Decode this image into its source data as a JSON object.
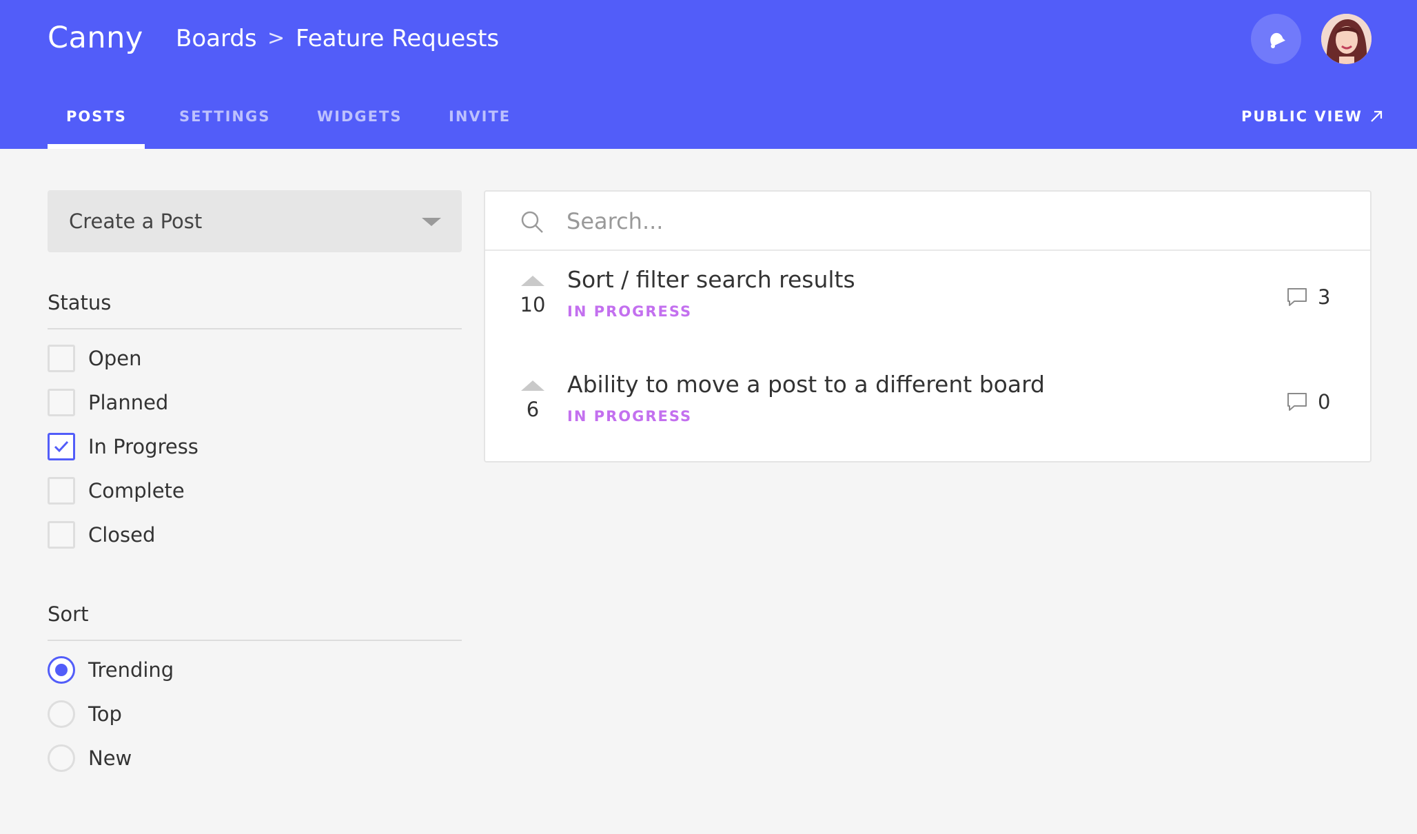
{
  "header": {
    "logo": "Canny",
    "breadcrumb": {
      "boards": "Boards",
      "separator": ">",
      "current": "Feature Requests"
    },
    "tabs": [
      {
        "label": "POSTS",
        "active": true
      },
      {
        "label": "SETTINGS",
        "active": false
      },
      {
        "label": "WIDGETS",
        "active": false
      },
      {
        "label": "INVITE",
        "active": false
      }
    ],
    "public_view": "PUBLIC VIEW",
    "icons": {
      "notifications": "bell-icon",
      "external": "arrow-up-right-icon"
    },
    "bg_color": "#525df9"
  },
  "sidebar": {
    "create_post": "Create a Post",
    "status": {
      "title": "Status",
      "options": [
        {
          "label": "Open",
          "checked": false
        },
        {
          "label": "Planned",
          "checked": false
        },
        {
          "label": "In Progress",
          "checked": true
        },
        {
          "label": "Complete",
          "checked": false
        },
        {
          "label": "Closed",
          "checked": false
        }
      ]
    },
    "sort": {
      "title": "Sort",
      "options": [
        {
          "label": "Trending",
          "selected": true
        },
        {
          "label": "Top",
          "selected": false
        },
        {
          "label": "New",
          "selected": false
        }
      ]
    }
  },
  "main": {
    "search": {
      "placeholder": "Search..."
    },
    "posts": [
      {
        "votes": "10",
        "title": "Sort / filter search results",
        "status": "IN PROGRESS",
        "comments": "3"
      },
      {
        "votes": "6",
        "title": "Ability to move a post to a different board",
        "status": "IN PROGRESS",
        "comments": "0"
      }
    ],
    "status_color": "#c370ef",
    "accent_color": "#525df9"
  }
}
